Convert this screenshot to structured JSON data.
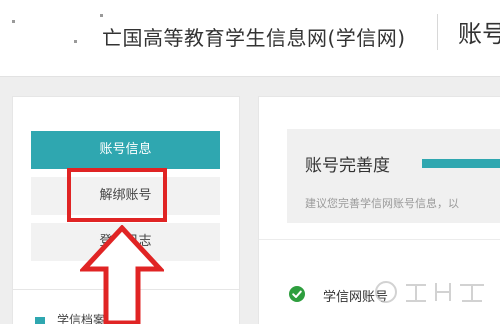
{
  "header": {
    "site_title": "亡国高等教育学生信息网(学信网)",
    "section_title": "账号"
  },
  "sidebar": {
    "items": [
      {
        "label": "账号信息",
        "active": true
      },
      {
        "label": "解绑账号",
        "active": false
      },
      {
        "label": "登录日志",
        "active": false
      }
    ],
    "profile_link": "学信档案"
  },
  "main": {
    "completion_title": "账号完善度",
    "completion_hint": "建议您完善学信网账号信息，以",
    "account_row_label": "学信网账号"
  },
  "colors": {
    "accent": "#2fa7b0",
    "annotation": "#e02424",
    "check": "#2e9e3e"
  },
  "watermark_icon": "baidu-jingyan-watermark"
}
